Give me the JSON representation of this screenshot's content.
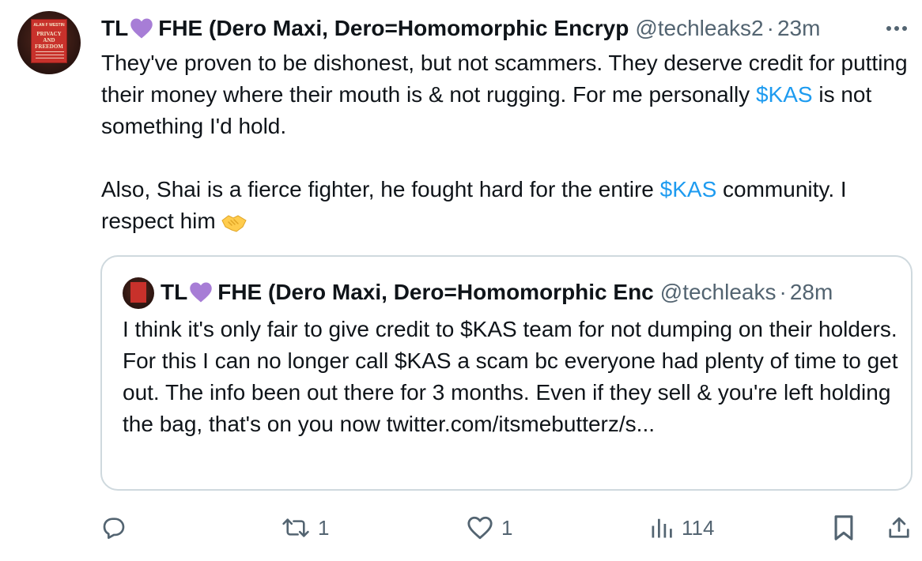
{
  "tweet": {
    "name_prefix": "TL",
    "name_rest": "FHE (Dero Maxi, Dero=Homomorphic Encryp",
    "handle": "@techleaks2",
    "separator": "·",
    "time": "23m",
    "text": {
      "line1": "They've proven to be dishonest, but not scammers. They deserve credit for putting their money where their mouth is & not rugging. For me personally ",
      "cashtag1": "$KAS",
      "line1_end": " is not something I'd hold.",
      "line2": "Also, Shai is a fierce fighter, he fought hard for the entire ",
      "cashtag2": "$KAS",
      "line2_end": " community. I respect him"
    }
  },
  "quote": {
    "name_prefix": "TL",
    "name_rest": "FHE (Dero Maxi, Dero=Homomorphic Enc",
    "handle": "@techleaks",
    "separator": "·",
    "time": "28m",
    "text": "I think it's only fair to give credit to $KAS team for not dumping on their holders. For this I can no longer call $KAS a scam bc everyone had plenty of time to get out. The info been out there for 3 months. Even if they sell & you're left holding the bag, that's on you now twitter.com/itsmebutterz/s..."
  },
  "actions": {
    "reply_count": "",
    "retweet_count": "1",
    "like_count": "1",
    "views_count": "114"
  },
  "avatar": {
    "book_author": "ALAN F WESTIN",
    "book_title": "PRIVACY AND FREEDOM"
  },
  "icons": [
    "more-icon",
    "reply-icon",
    "retweet-icon",
    "like-icon",
    "views-icon",
    "bookmark-icon",
    "share-icon",
    "purple-heart-icon",
    "handshake-icon"
  ],
  "colors": {
    "link": "#1d9bf0",
    "secondary_text": "#536471",
    "heart": "#a77dd6",
    "border": "#cfd9de"
  }
}
